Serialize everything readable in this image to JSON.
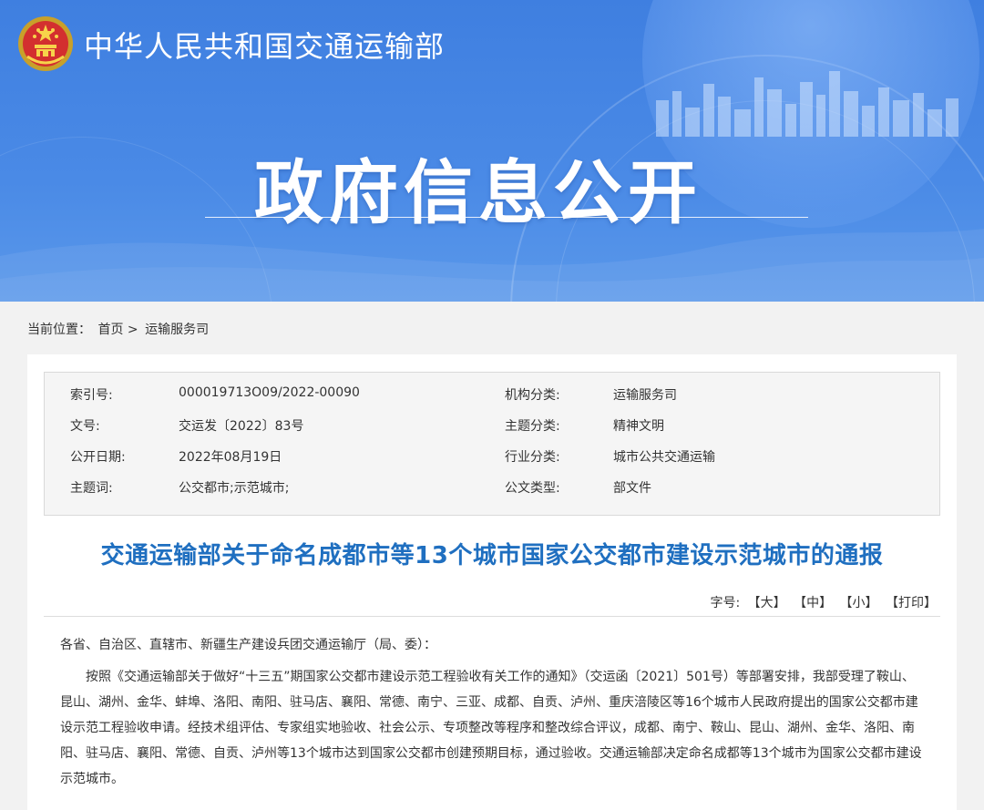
{
  "header": {
    "ministry_name": "中华人民共和国交通运输部",
    "banner_title": "政府信息公开"
  },
  "breadcrumb": {
    "label": "当前位置：",
    "home": "首页",
    "separator": ">",
    "current": "运输服务司"
  },
  "meta": {
    "rows": [
      {
        "k1": "索引号:",
        "v1": "000019713O09/2022-00090",
        "k2": "机构分类:",
        "v2": "运输服务司"
      },
      {
        "k1": "文号:",
        "v1": "交运发〔2022〕83号",
        "k2": "主题分类:",
        "v2": "精神文明"
      },
      {
        "k1": "公开日期:",
        "v1": "2022年08月19日",
        "k2": "行业分类:",
        "v2": "城市公共交通运输"
      },
      {
        "k1": "主题词:",
        "v1": "公交都市;示范城市;",
        "k2": "公文类型:",
        "v2": "部文件"
      }
    ]
  },
  "article": {
    "title": "交通运输部关于命名成都市等13个城市国家公交都市建设示范城市的通报",
    "font_size_label": "字号:",
    "font_large": "【大】",
    "font_medium": "【中】",
    "font_small": "【小】",
    "print": "【打印】",
    "salutation": "各省、自治区、直辖市、新疆生产建设兵团交通运输厅（局、委）：",
    "paragraph1": "按照《交通运输部关于做好“十三五”期国家公交都市建设示范工程验收有关工作的通知》（交运函〔2021〕501号）等部署安排，我部受理了鞍山、昆山、湖州、金华、蚌埠、洛阳、南阳、驻马店、襄阳、常德、南宁、三亚、成都、自贡、泸州、重庆涪陵区等16个城市人民政府提出的国家公交都市建设示范工程验收申请。经技术组评估、专家组实地验收、社会公示、专项整改等程序和整改综合评议，成都、南宁、鞍山、昆山、湖州、金华、洛阳、南阳、驻马店、襄阳、常德、自贡、泸州等13个城市达到国家公交都市创建预期目标，通过验收。交通运输部决定命名成都等13个城市为国家公交都市建设示范城市。"
  }
}
